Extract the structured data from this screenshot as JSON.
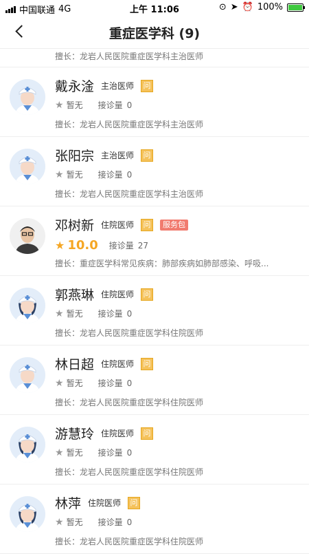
{
  "status_bar": {
    "carrier": "中国联通",
    "network": "4G",
    "time": "上午 11:06",
    "battery": "100%",
    "battery_level": 1.0
  },
  "header": {
    "title": "重症医学科 (9)"
  },
  "previous_item": {
    "specialty": "擅长：龙岩人民医院重症医学科主治医师"
  },
  "doctors": [
    {
      "name": "戴永淦",
      "title": "主治医师",
      "ask_badge": "问",
      "rating": "暂无",
      "consult_label": "接诊量",
      "consult_count": "0",
      "specialty": "擅长：龙岩人民医院重症医学科主治医师",
      "avatar": "doctor-icon"
    },
    {
      "name": "张阳宗",
      "title": "主治医师",
      "ask_badge": "问",
      "rating": "暂无",
      "consult_label": "接诊量",
      "consult_count": "0",
      "specialty": "擅长：龙岩人民医院重症医学科主治医师",
      "avatar": "doctor-icon"
    },
    {
      "name": "邓树新",
      "title": "住院医师",
      "ask_badge": "问",
      "package_badge": "服务包",
      "rating": "10.0",
      "consult_label": "接诊量",
      "consult_count": "27",
      "specialty": "擅长：重症医学科常见疾病：肺部疾病如肺部感染、呼吸...",
      "avatar": "photo"
    },
    {
      "name": "郭燕琳",
      "title": "住院医师",
      "ask_badge": "问",
      "rating": "暂无",
      "consult_label": "接诊量",
      "consult_count": "0",
      "specialty": "擅长：龙岩人民医院重症医学科住院医师",
      "avatar": "nurse-icon"
    },
    {
      "name": "林日超",
      "title": "住院医师",
      "ask_badge": "问",
      "rating": "暂无",
      "consult_label": "接诊量",
      "consult_count": "0",
      "specialty": "擅长：龙岩人民医院重症医学科住院医师",
      "avatar": "doctor-icon"
    },
    {
      "name": "游慧玲",
      "title": "住院医师",
      "ask_badge": "问",
      "rating": "暂无",
      "consult_label": "接诊量",
      "consult_count": "0",
      "specialty": "擅长：龙岩人民医院重症医学科住院医师",
      "avatar": "nurse-icon"
    },
    {
      "name": "林萍",
      "title": "住院医师",
      "ask_badge": "问",
      "rating": "暂无",
      "consult_label": "接诊量",
      "consult_count": "0",
      "specialty": "擅长：龙岩人民医院重症医学科住院医师",
      "avatar": "nurse-icon"
    }
  ],
  "colors": {
    "accent": "#f5a623",
    "ask_badge": "#f5c25b",
    "package_badge": "#f17b6f",
    "battery": "#3fc93f"
  }
}
